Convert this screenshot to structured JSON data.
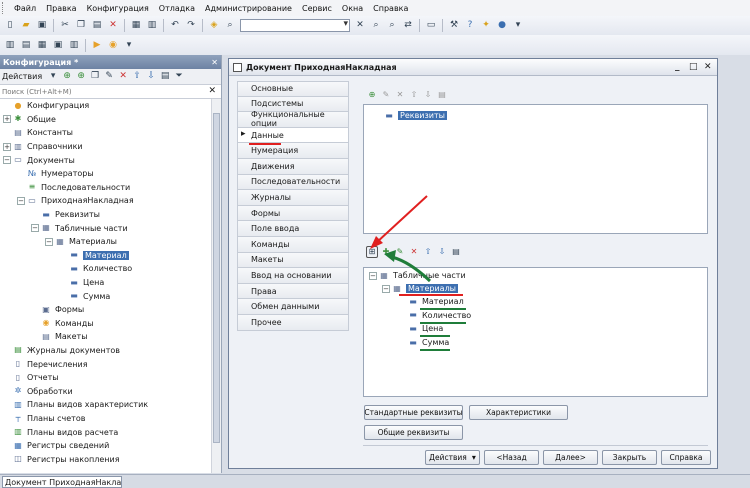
{
  "menu": [
    "Файл",
    "Правка",
    "Конфигурация",
    "Отладка",
    "Администрирование",
    "Сервис",
    "Окна",
    "Справка"
  ],
  "config_panel": {
    "title": "Конфигурация *",
    "actions_label": "Действия",
    "search_placeholder": "Поиск (Ctrl+Alt+M)"
  },
  "tree": [
    {
      "label": "Конфигурация",
      "level": 0,
      "expander": "none",
      "icon": "config-icon",
      "icon_glyph": "●",
      "icon_color": "#e6a12a"
    },
    {
      "label": "Общие",
      "level": 0,
      "expander": "+",
      "icon": "common-icon",
      "icon_glyph": "✱",
      "icon_color": "#3b8f3b"
    },
    {
      "label": "Константы",
      "level": 0,
      "expander": "none",
      "icon": "constants-icon",
      "icon_glyph": "▤",
      "icon_color": "#5b6c8f"
    },
    {
      "label": "Справочники",
      "level": 0,
      "expander": "+",
      "icon": "catalogs-icon",
      "icon_glyph": "▥",
      "icon_color": "#5b6c8f"
    },
    {
      "label": "Документы",
      "level": 0,
      "expander": "−",
      "icon": "documents-icon",
      "icon_glyph": "▭",
      "icon_color": "#5b6c8f"
    },
    {
      "label": "Нумераторы",
      "level": 1,
      "expander": "none",
      "icon": "numerators-icon",
      "icon_glyph": "№",
      "icon_color": "#3b6fb0"
    },
    {
      "label": "Последовательности",
      "level": 1,
      "expander": "none",
      "icon": "sequences-icon",
      "icon_glyph": "≡",
      "icon_color": "#3b8f3b"
    },
    {
      "label": "ПриходнаяНакладная",
      "level": 1,
      "expander": "−",
      "icon": "document-icon",
      "icon_glyph": "▭",
      "icon_color": "#5b6c8f"
    },
    {
      "label": "Реквизиты",
      "level": 2,
      "expander": "none",
      "icon": "attributes-icon",
      "icon_glyph": "▬",
      "icon_color": "#4a6ea8"
    },
    {
      "label": "Табличные части",
      "level": 2,
      "expander": "−",
      "icon": "tabular-sections-icon",
      "icon_glyph": "▦",
      "icon_color": "#5b6c8f"
    },
    {
      "label": "Материалы",
      "level": 3,
      "expander": "−",
      "icon": "table-icon",
      "icon_glyph": "▦",
      "icon_color": "#5b6c8f"
    },
    {
      "label": "Материал",
      "level": 4,
      "expander": "none",
      "icon": "attribute-icon",
      "icon_glyph": "▬",
      "icon_color": "#4a6ea8",
      "selected": true
    },
    {
      "label": "Количество",
      "level": 4,
      "expander": "none",
      "icon": "attribute-icon",
      "icon_glyph": "▬",
      "icon_color": "#4a6ea8"
    },
    {
      "label": "Цена",
      "level": 4,
      "expander": "none",
      "icon": "attribute-icon",
      "icon_glyph": "▬",
      "icon_color": "#4a6ea8"
    },
    {
      "label": "Сумма",
      "level": 4,
      "expander": "none",
      "icon": "attribute-icon",
      "icon_glyph": "▬",
      "icon_color": "#4a6ea8"
    },
    {
      "label": "Формы",
      "level": 2,
      "expander": "none",
      "icon": "forms-icon",
      "icon_glyph": "▣",
      "icon_color": "#5b6c8f"
    },
    {
      "label": "Команды",
      "level": 2,
      "expander": "none",
      "icon": "commands-icon",
      "icon_glyph": "◉",
      "icon_color": "#e6a12a"
    },
    {
      "label": "Макеты",
      "level": 2,
      "expander": "none",
      "icon": "templates-icon",
      "icon_glyph": "▤",
      "icon_color": "#5b6c8f"
    },
    {
      "label": "Журналы документов",
      "level": 0,
      "expander": "none",
      "icon": "journals-icon",
      "icon_glyph": "▤",
      "icon_color": "#3b8f3b"
    },
    {
      "label": "Перечисления",
      "level": 0,
      "expander": "none",
      "icon": "enums-icon",
      "icon_glyph": "▯",
      "icon_color": "#5b6c8f"
    },
    {
      "label": "Отчеты",
      "level": 0,
      "expander": "none",
      "icon": "reports-icon",
      "icon_glyph": "▯",
      "icon_color": "#5b6c8f"
    },
    {
      "label": "Обработки",
      "level": 0,
      "expander": "none",
      "icon": "dataprocessors-icon",
      "icon_glyph": "✲",
      "icon_color": "#3b6fb0"
    },
    {
      "label": "Планы видов характеристик",
      "level": 0,
      "expander": "none",
      "icon": "chart-of-characteristics-icon",
      "icon_glyph": "▥",
      "icon_color": "#3b6fb0"
    },
    {
      "label": "Планы счетов",
      "level": 0,
      "expander": "none",
      "icon": "chart-of-accounts-icon",
      "icon_glyph": "┬",
      "icon_color": "#3b6fb0"
    },
    {
      "label": "Планы видов расчета",
      "level": 0,
      "expander": "none",
      "icon": "chart-of-calculation-icon",
      "icon_glyph": "▥",
      "icon_color": "#3b8f3b"
    },
    {
      "label": "Регистры сведений",
      "level": 0,
      "expander": "none",
      "icon": "info-registers-icon",
      "icon_glyph": "▦",
      "icon_color": "#3b6fb0"
    },
    {
      "label": "Регистры накопления",
      "level": 0,
      "expander": "none",
      "icon": "accum-registers-icon",
      "icon_glyph": "◫",
      "icon_color": "#5b6c8f"
    }
  ],
  "doc_window": {
    "title": "Документ ПриходнаяНакладная",
    "nav": [
      "Основные",
      "Подсистемы",
      "Функциональные опции",
      "Данные",
      "Нумерация",
      "Движения",
      "Последовательности",
      "Журналы",
      "Формы",
      "Поле ввода",
      "Команды",
      "Макеты",
      "Ввод на основании",
      "Права",
      "Обмен данными",
      "Прочее"
    ],
    "nav_active": 3,
    "attributes_node": "Реквизиты",
    "tabular_root": "Табличные части",
    "tabular_table": "Материалы",
    "tabular_items": [
      "Материал",
      "Количество",
      "Цена",
      "Сумма"
    ],
    "buttons": {
      "standard_attrs": "Стандартные реквизиты",
      "characteristics": "Характеристики",
      "common_attrs": "Общие реквизиты",
      "actions": "Действия",
      "back": "<Назад",
      "next": "Далее>",
      "close": "Закрыть",
      "help": "Справка"
    }
  },
  "taskbar": {
    "item": "Документ ПриходнаяНакла..."
  },
  "colors": {
    "annotation_red": "#e02020",
    "annotation_green": "#1f7d3a",
    "selection": "#3d6fb0"
  }
}
